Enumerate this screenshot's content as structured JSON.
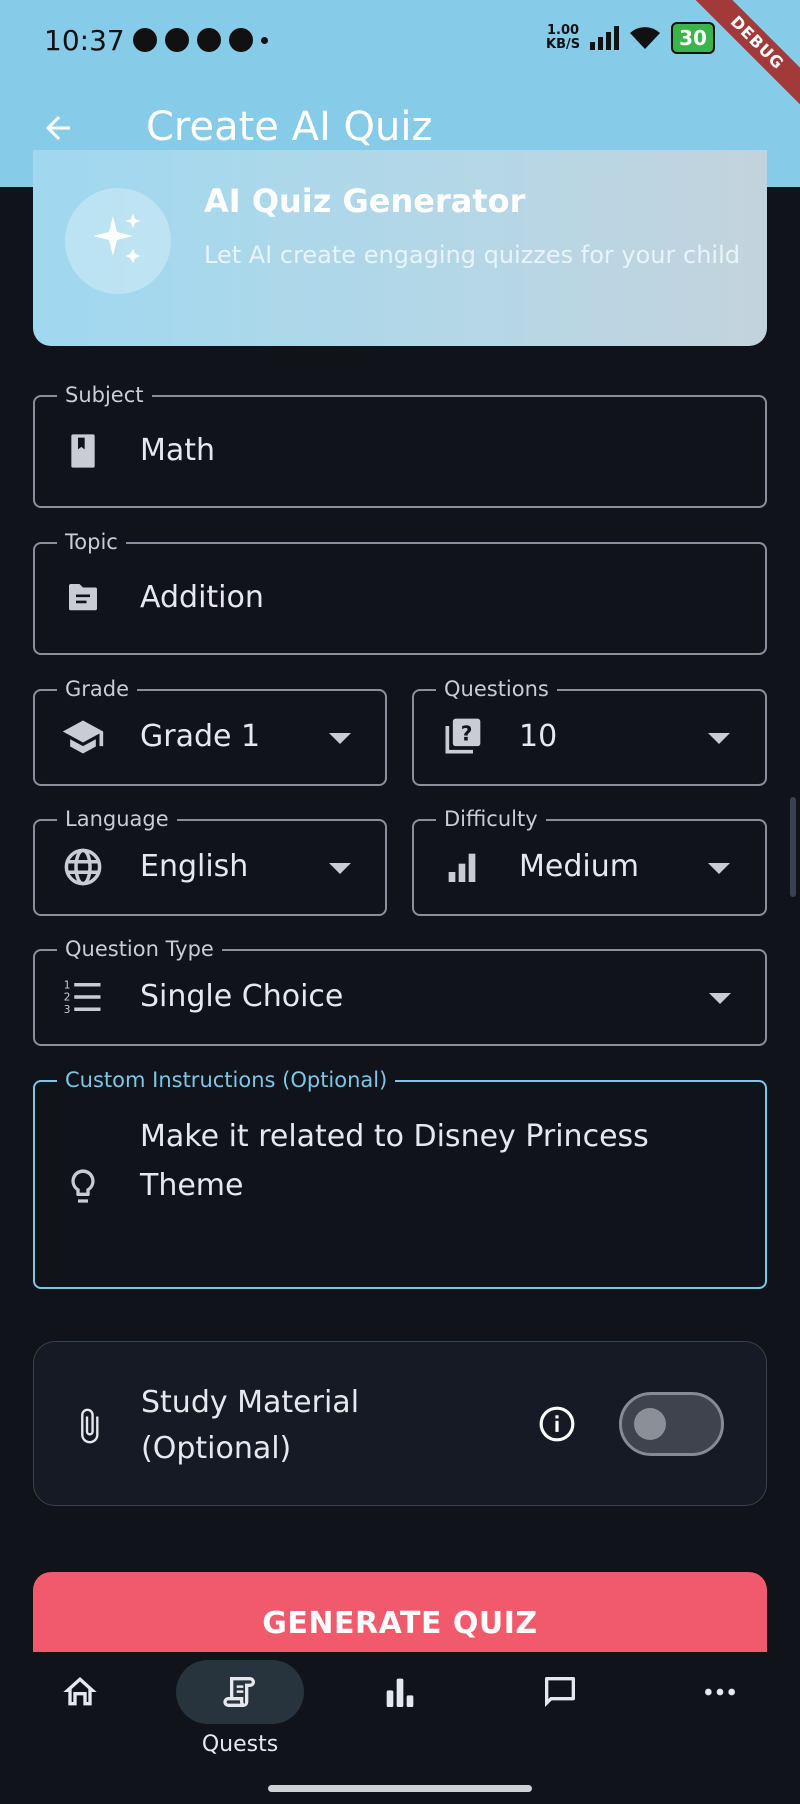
{
  "status_bar": {
    "time": "10:37",
    "net_speed_value": "1.00",
    "net_speed_unit": "KB/S",
    "battery": "30",
    "debug_banner": "DEBUG"
  },
  "app_bar": {
    "title": "Create AI Quiz"
  },
  "hero": {
    "title": "AI Quiz Generator",
    "subtitle": "Let AI create engaging quizzes for your child"
  },
  "form": {
    "subject": {
      "label": "Subject",
      "value": "Math"
    },
    "topic": {
      "label": "Topic",
      "value": "Addition"
    },
    "grade": {
      "label": "Grade",
      "value": "Grade 1"
    },
    "questions": {
      "label": "Questions",
      "value": "10"
    },
    "language": {
      "label": "Language",
      "value": "English"
    },
    "difficulty": {
      "label": "Difficulty",
      "value": "Medium"
    },
    "question_type": {
      "label": "Question Type",
      "value": "Single Choice"
    },
    "custom_instructions": {
      "label": "Custom Instructions (Optional)",
      "value": "Make it related to Disney Princess Theme"
    }
  },
  "study_material": {
    "label": "Study Material (Optional)",
    "toggle_on": false
  },
  "generate_button": {
    "label": "GENERATE QUIZ"
  },
  "bottom_nav": {
    "active": "Quests",
    "items": [
      {
        "icon": "home-icon"
      },
      {
        "icon": "scroll-icon",
        "label": "Quests"
      },
      {
        "icon": "bar-chart-icon"
      },
      {
        "icon": "chat-icon"
      },
      {
        "icon": "more-icon"
      }
    ]
  },
  "colors": {
    "app_bar": "#86cbe8",
    "background": "#11131a",
    "accent": "#7cc6e8",
    "generate_button": "#f05a6c"
  }
}
